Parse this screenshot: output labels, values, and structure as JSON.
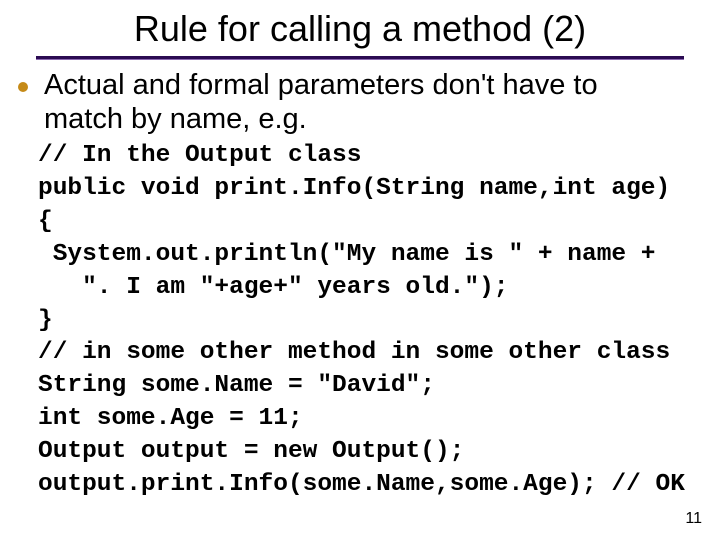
{
  "title": "Rule for calling a method (2)",
  "bullet": "Actual and formal parameters don't have to match by name, e.g.",
  "code": {
    "l1": "// In the Output class",
    "l2": "public void print.Info(String name,int age)",
    "l3": "{",
    "l4": " System.out.println(\"My name is \" + name +",
    "l5": "   \". I am \"+age+\" years old.\");",
    "l6": "}",
    "l7": "// in some other method in some other class",
    "l8": "String some.Name = \"David\";",
    "l9": "int some.Age = 11;",
    "l10": "Output output = new Output();",
    "l11": "output.print.Info(some.Name,some.Age); // OK"
  },
  "pagenum": "11"
}
